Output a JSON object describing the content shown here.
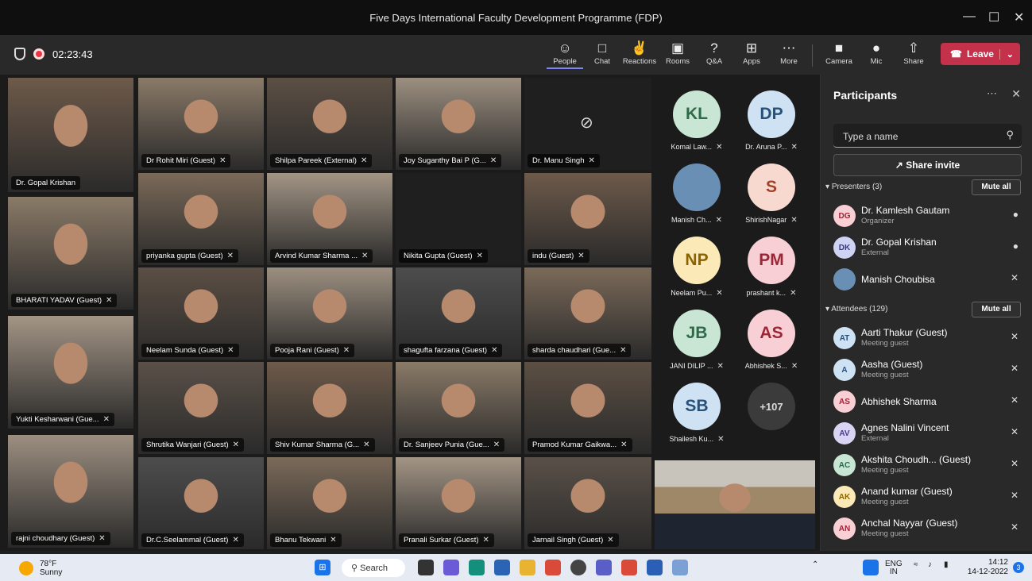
{
  "window": {
    "title": "Five Days International Faculty Development Programme (FDP)",
    "minimize": "—",
    "maximize": "☐",
    "close": "✕"
  },
  "meeting": {
    "timer": "02:23:43"
  },
  "toolbar": {
    "people": "People",
    "chat": "Chat",
    "reactions": "Reactions",
    "rooms": "Rooms",
    "qa": "Q&A",
    "apps": "Apps",
    "more": "More",
    "camera": "Camera",
    "mic": "Mic",
    "share": "Share",
    "leave": "Leave"
  },
  "tiles": [
    "Dr. Gopal Krishan",
    "Dr Rohit Miri (Guest)",
    "Shilpa Pareek (External)",
    "Joy Suganthy Bai P (G...",
    "Dr. Manu Singh",
    "priyanka gupta (Guest)",
    "Arvind Kumar Sharma ...",
    "Nikita Gupta (Guest)",
    "indu (Guest)",
    "BHARATI YADAV (Guest)",
    "Neelam Sunda (Guest)",
    "Pooja Rani (Guest)",
    "shagufta farzana (Guest)",
    "sharda chaudhari (Gue...",
    "Yukti Kesharwani (Gue...",
    "Shrutika Wanjari (Guest)",
    "Shiv Kumar Sharma (G...",
    "Dr. Sanjeev Punia (Gue...",
    "Pramod Kumar Gaikwa...",
    "rajni choudhary (Guest)",
    "Dr.C.Seelammal (Guest)",
    "Bhanu Tekwani",
    "Pranali Surkar (Guest)",
    "Jarnail Singh (Guest)"
  ],
  "avatars": [
    {
      "initials": "KL",
      "label": "Komal Law...",
      "bg": "#c9e6d4",
      "fg": "#2d6a48"
    },
    {
      "initials": "DP",
      "label": "Dr. Aruna P...",
      "bg": "#cfe2f3",
      "fg": "#28517a"
    },
    {
      "initials": "",
      "label": "Manish Ch...",
      "bg": "#6a8fb5",
      "fg": "#fff"
    },
    {
      "initials": "S",
      "label": "ShirishNagar",
      "bg": "#f8d9cf",
      "fg": "#a0422a"
    },
    {
      "initials": "NP",
      "label": "Neelam Pu...",
      "bg": "#fbeab8",
      "fg": "#8a6300"
    },
    {
      "initials": "PM",
      "label": "prashant k...",
      "bg": "#f7cfd4",
      "fg": "#9c2536"
    },
    {
      "initials": "JB",
      "label": "JANI DILIP ...",
      "bg": "#c9e6d4",
      "fg": "#2d6a48"
    },
    {
      "initials": "AS",
      "label": "Abhishek S...",
      "bg": "#f7cfd4",
      "fg": "#9c2536"
    },
    {
      "initials": "SB",
      "label": "Shailesh Ku...",
      "bg": "#cfe2f3",
      "fg": "#28517a"
    },
    {
      "initials": "+107",
      "label": "",
      "bg": "#3b3b3b",
      "fg": "#ddd"
    }
  ],
  "participants": {
    "title": "Participants",
    "search_placeholder": "Type a name",
    "share_invite": "Share invite",
    "presenters_label": "Presenters (3)",
    "attendees_label": "Attendees (129)",
    "mute_all": "Mute all",
    "presenters": [
      {
        "initials": "DG",
        "name": "Dr. Kamlesh Gautam",
        "sub": "Organizer",
        "bg": "#f7cfd4",
        "fg": "#9c2536"
      },
      {
        "initials": "DK",
        "name": "Dr. Gopal Krishan",
        "sub": "External",
        "bg": "#cfd3f3",
        "fg": "#363a7a"
      },
      {
        "initials": "",
        "name": "Manish Choubisa",
        "sub": "",
        "bg": "#6a8fb5",
        "fg": "#fff"
      }
    ],
    "attendees": [
      {
        "initials": "AT",
        "name": "Aarti Thakur (Guest)",
        "sub": "Meeting guest",
        "bg": "#cfe2f3",
        "fg": "#28517a"
      },
      {
        "initials": "A",
        "name": "Aasha (Guest)",
        "sub": "Meeting guest",
        "bg": "#cfe2f3",
        "fg": "#28517a"
      },
      {
        "initials": "AS",
        "name": "Abhishek Sharma",
        "sub": "",
        "bg": "#f7cfd4",
        "fg": "#9c2536"
      },
      {
        "initials": "AV",
        "name": "Agnes Nalini Vincent",
        "sub": "External",
        "bg": "#d9d4f3",
        "fg": "#4a3a8a"
      },
      {
        "initials": "AC",
        "name": "Akshita Choudh... (Guest)",
        "sub": "Meeting guest",
        "bg": "#c9e6d4",
        "fg": "#2d6a48"
      },
      {
        "initials": "AK",
        "name": "Anand kumar (Guest)",
        "sub": "Meeting guest",
        "bg": "#fbeab8",
        "fg": "#8a6300"
      },
      {
        "initials": "AN",
        "name": "Anchal Nayyar (Guest)",
        "sub": "Meeting guest",
        "bg": "#f7cfd4",
        "fg": "#9c2536"
      }
    ]
  },
  "taskbar": {
    "temp": "78°F",
    "weather": "Sunny",
    "search": "Search",
    "lang1": "ENG",
    "lang2": "IN",
    "time": "14:12",
    "date": "14-12-2022",
    "notif": "3"
  }
}
